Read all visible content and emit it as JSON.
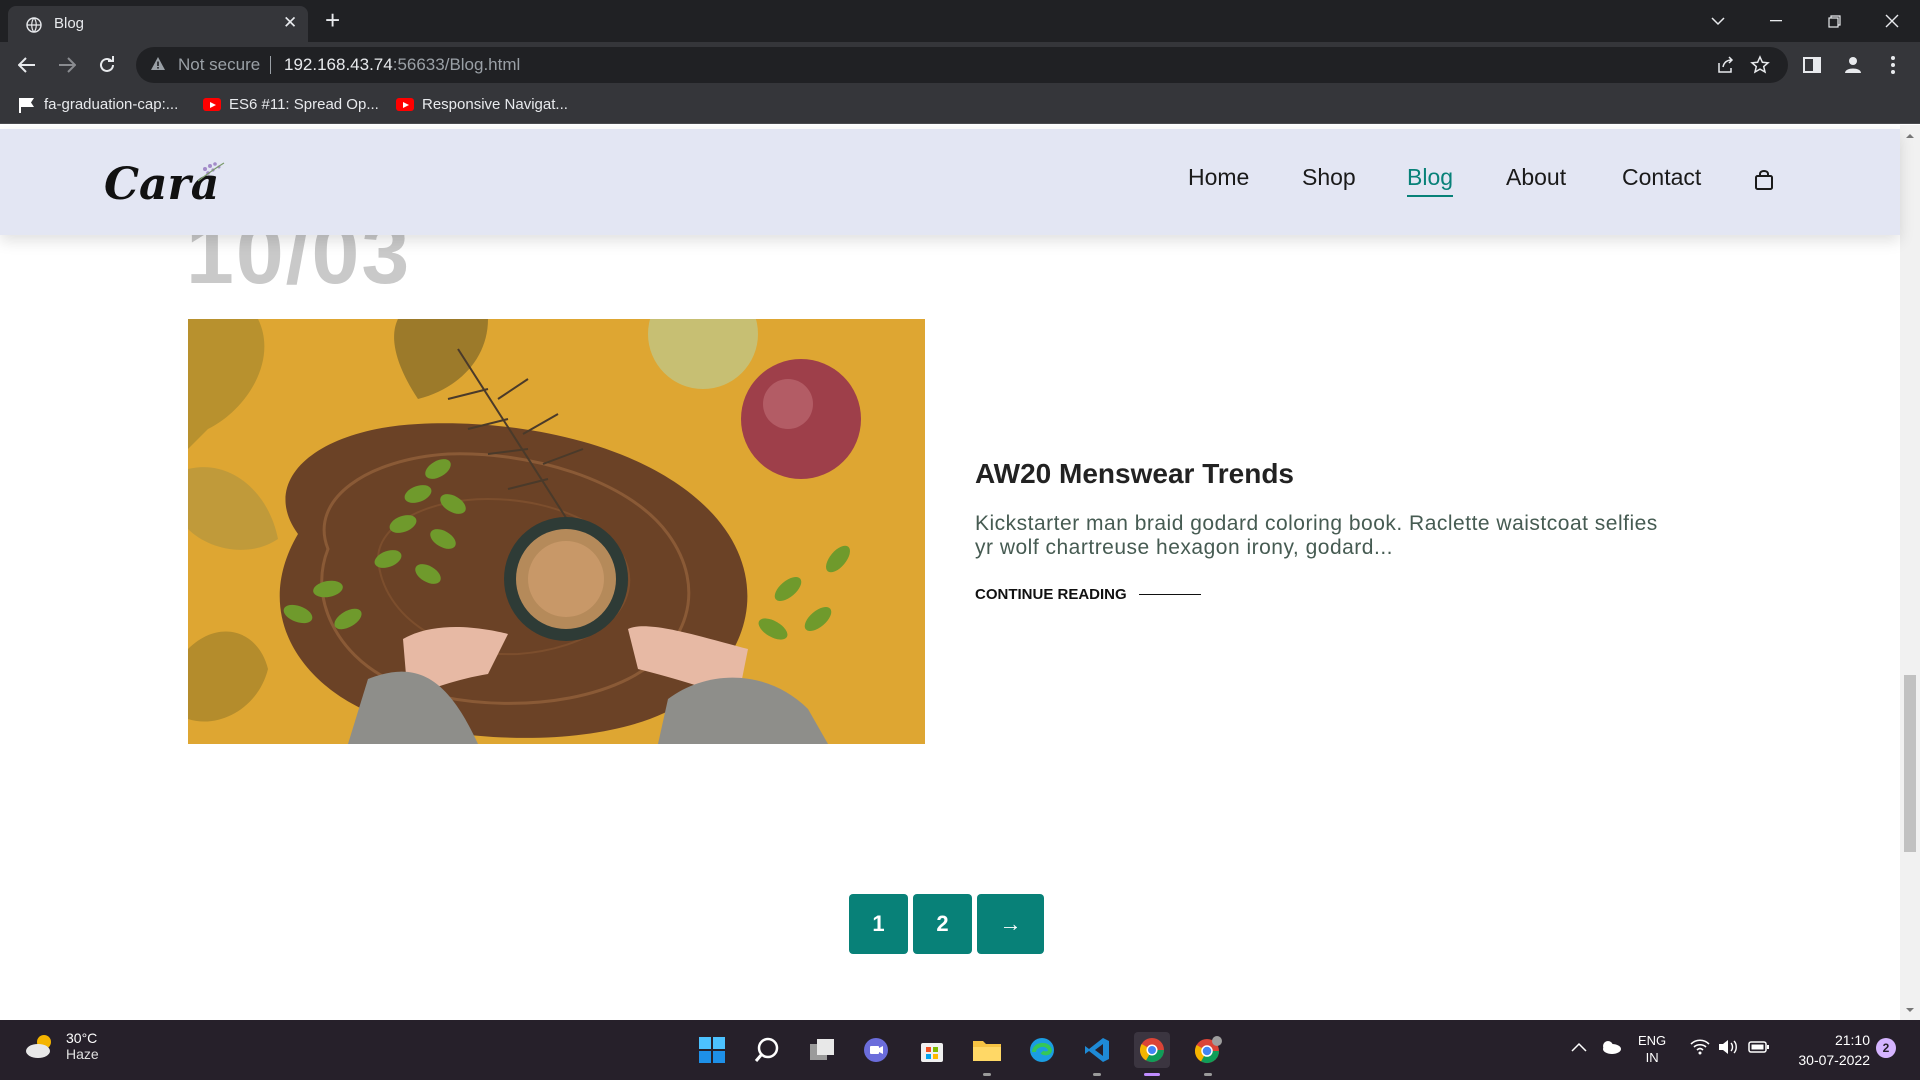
{
  "browser": {
    "tab_title": "Blog",
    "new_tab_label": "+",
    "security_label": "Not secure",
    "url_host": "192.168.43.74",
    "url_rest": ":56633/Blog.html",
    "bookmarks": [
      {
        "label": "fa-graduation-cap:...",
        "icon": "flag-icon"
      },
      {
        "label": "ES6 #11: Spread Op...",
        "icon": "youtube-icon"
      },
      {
        "label": "Responsive Navigat...",
        "icon": "youtube-icon"
      }
    ]
  },
  "site": {
    "logo_text": "Cara",
    "nav": [
      "Home",
      "Shop",
      "Blog",
      "About",
      "Contact"
    ],
    "active_nav": "Blog",
    "accent_color": "#088178",
    "header_bg": "#e3e6f3"
  },
  "post": {
    "date": "10/03",
    "title": "AW20 Menswear Trends",
    "excerpt": "Kickstarter man braid godard coloring book. Raclette waistcoat selfies yr wolf chartreuse hexagon irony, godard...",
    "cta": "CONTINUE READING"
  },
  "pagination": {
    "pages": [
      "1",
      "2"
    ],
    "next_label": "→"
  },
  "taskbar": {
    "temperature": "30°C",
    "weather": "Haze",
    "lang_top": "ENG",
    "lang_bottom": "IN",
    "time": "21:10",
    "date": "30-07-2022",
    "notifications": "2"
  }
}
